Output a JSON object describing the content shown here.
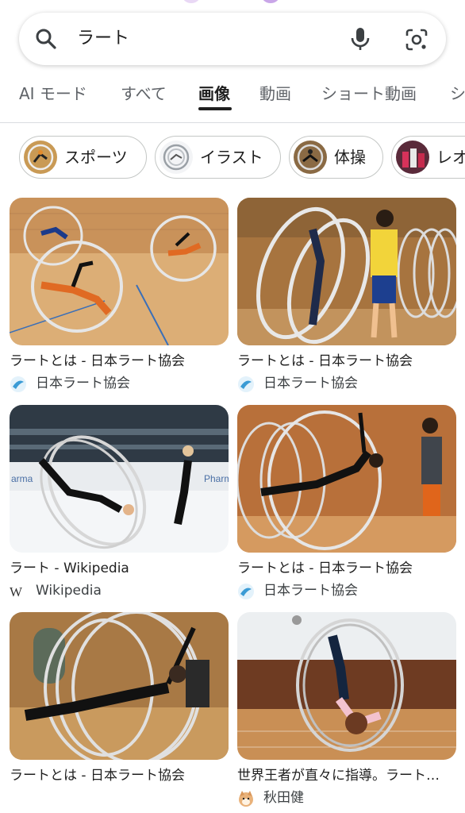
{
  "search": {
    "query": "ラート"
  },
  "tabs": [
    {
      "label": "AI モード",
      "active": false
    },
    {
      "label": "すべて",
      "active": false
    },
    {
      "label": "画像",
      "active": true
    },
    {
      "label": "動画",
      "active": false
    },
    {
      "label": "ショート動画",
      "active": false
    },
    {
      "label": "シ",
      "active": false
    }
  ],
  "chips": [
    {
      "label": "スポーツ"
    },
    {
      "label": "イラスト"
    },
    {
      "label": "体操"
    },
    {
      "label": "レオ"
    }
  ],
  "results": [
    {
      "title": "ラートとは - 日本ラート協会",
      "source": "日本ラート協会",
      "favicon": "jra-logo-icon"
    },
    {
      "title": "ラートとは - 日本ラート協会",
      "source": "日本ラート協会",
      "favicon": "jra-logo-icon"
    },
    {
      "title": "ラート - Wikipedia",
      "source": "Wikipedia",
      "favicon": "wikipedia-icon"
    },
    {
      "title": "ラートとは - 日本ラート協会",
      "source": "日本ラート協会",
      "favicon": "jra-logo-icon"
    },
    {
      "title": "ラートとは - 日本ラート協会",
      "source": "",
      "favicon": ""
    },
    {
      "title": "世界王者が直々に指導。ラート…",
      "source": "秋田健",
      "favicon": "shiba-dog-avatar-icon"
    }
  ],
  "colors": {
    "floor": "#d9a56b",
    "wheel": "#d8d8d8",
    "text_secondary": "#5f6368"
  }
}
